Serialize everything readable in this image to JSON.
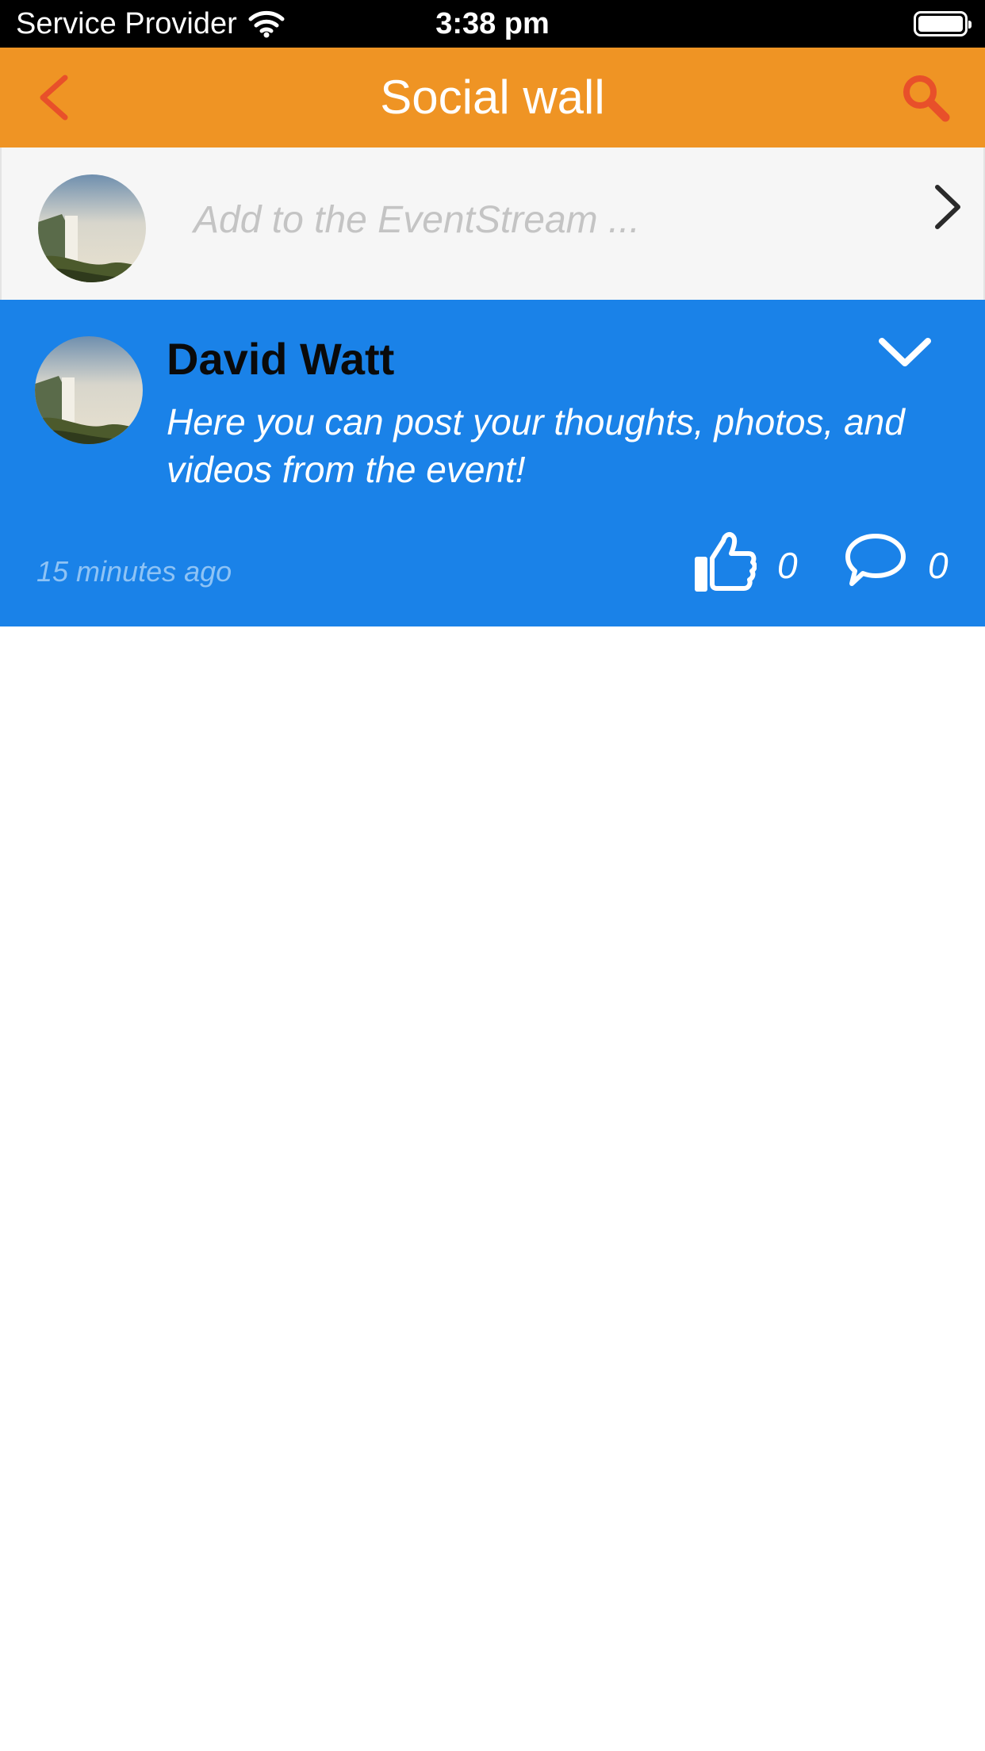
{
  "status_bar": {
    "carrier": "Service Provider",
    "time": "3:38 pm",
    "icons": [
      "wifi-icon",
      "battery-icon"
    ]
  },
  "header": {
    "title": "Social wall",
    "back_icon": "chevron-left-icon",
    "search_icon": "search-icon"
  },
  "compose": {
    "placeholder": "Add to the EventStream ...",
    "avatar": "user-avatar",
    "action_icon": "chevron-right-icon"
  },
  "posts": [
    {
      "author": "David Watt",
      "message": "Here you can post your thoughts, photos, and videos from the event!",
      "timestamp": "15 minutes ago",
      "likes": "0",
      "comments": "0",
      "expand_icon": "chevron-down-icon"
    }
  ],
  "colors": {
    "header_bg": "#ef9424",
    "header_icon": "#e8502a",
    "post_bg": "#1a82e8",
    "compose_bg": "#f6f6f6"
  }
}
